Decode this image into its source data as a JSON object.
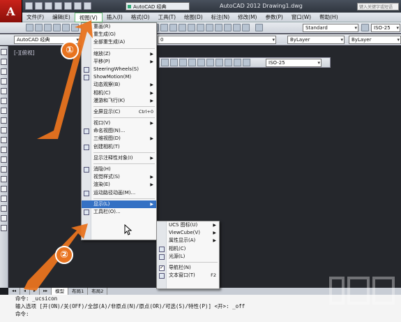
{
  "app": {
    "menu_button": "A",
    "title": "AutoCAD 2012   Drawing1.dwg",
    "workspace": "AutoCAD 经典",
    "help_search_placeholder": "键入关键字或短语"
  },
  "menubar": {
    "items": [
      "文件(F)",
      "编辑(E)",
      "视图(V)",
      "插入(I)",
      "格式(O)",
      "工具(T)",
      "绘图(D)",
      "标注(N)",
      "修改(M)",
      "参数(P)",
      "窗口(W)",
      "帮助(H)"
    ]
  },
  "toolbars": {
    "text_style": "Standard",
    "dim_style": "ISO-25",
    "dim_style_2": "ISO-25",
    "workspace_label": "AutoCAD 经典",
    "layer_value": "0",
    "color": "ByLayer",
    "linetype": "ByLayer"
  },
  "view": {
    "label": "[-][俯视]"
  },
  "dropdown": {
    "items": [
      {
        "label": "重画(R)"
      },
      {
        "label": "重生成(G)"
      },
      {
        "label": "全部重生成(A)"
      },
      {
        "sep": true
      },
      {
        "label": "缩放(Z)",
        "sub": true
      },
      {
        "label": "平移(P)",
        "sub": true
      },
      {
        "label": "SteeringWheels(S)",
        "icon": true
      },
      {
        "label": "ShowMotion(M)",
        "icon": true
      },
      {
        "label": "动态观察(B)",
        "sub": true
      },
      {
        "label": "相机(C)",
        "sub": true
      },
      {
        "label": "漫游和飞行(K)",
        "sub": true
      },
      {
        "sep": true
      },
      {
        "label": "全屏显示(C)",
        "shortcut": "Ctrl+0"
      },
      {
        "sep": true
      },
      {
        "label": "视口(V)",
        "sub": true
      },
      {
        "label": "命名视图(N)...",
        "icon": true
      },
      {
        "label": "三维视图(D)",
        "sub": true
      },
      {
        "label": "创建相机(T)",
        "icon": true
      },
      {
        "sep": true
      },
      {
        "label": "显示注释性对象(I)",
        "sub": true
      },
      {
        "sep": true
      },
      {
        "label": "消隐(H)",
        "icon": true
      },
      {
        "label": "视觉样式(S)",
        "sub": true
      },
      {
        "label": "渲染(E)",
        "sub": true
      },
      {
        "label": "运动路径动画(M)...",
        "icon": true
      },
      {
        "sep": true
      },
      {
        "label": "显示(L)",
        "sub": true,
        "highlight": true
      },
      {
        "label": "工具栏(O)...",
        "icon": true
      }
    ]
  },
  "submenu": {
    "items": [
      {
        "label": "UCS 图标(U)",
        "sub": true
      },
      {
        "label": "ViewCube(V)",
        "sub": true
      },
      {
        "label": "属性显示(A)",
        "sub": true
      },
      {
        "label": "相机(C)",
        "icon": true
      },
      {
        "label": "光源(L)",
        "icon": true
      },
      {
        "sep": true
      },
      {
        "label": "导航栏(N)",
        "check": true
      },
      {
        "label": "文本窗口(T)",
        "icon": true,
        "shortcut": "F2"
      }
    ]
  },
  "layout_tabs": [
    "模型",
    "布局1",
    "布局2"
  ],
  "command": {
    "line1": "命令: _ucsicon",
    "line2": "输入选项 [开(ON)/关(OFF)/全部(A)/非原点(N)/原点(OR)/可选(S)/特性(P)] <开>: _off",
    "line3": "命令:"
  },
  "callouts": {
    "step1": "①",
    "step2": "②"
  },
  "colors": {
    "accent": "#e8731f",
    "highlight": "#3471c4",
    "app_button": "#c9221a"
  }
}
